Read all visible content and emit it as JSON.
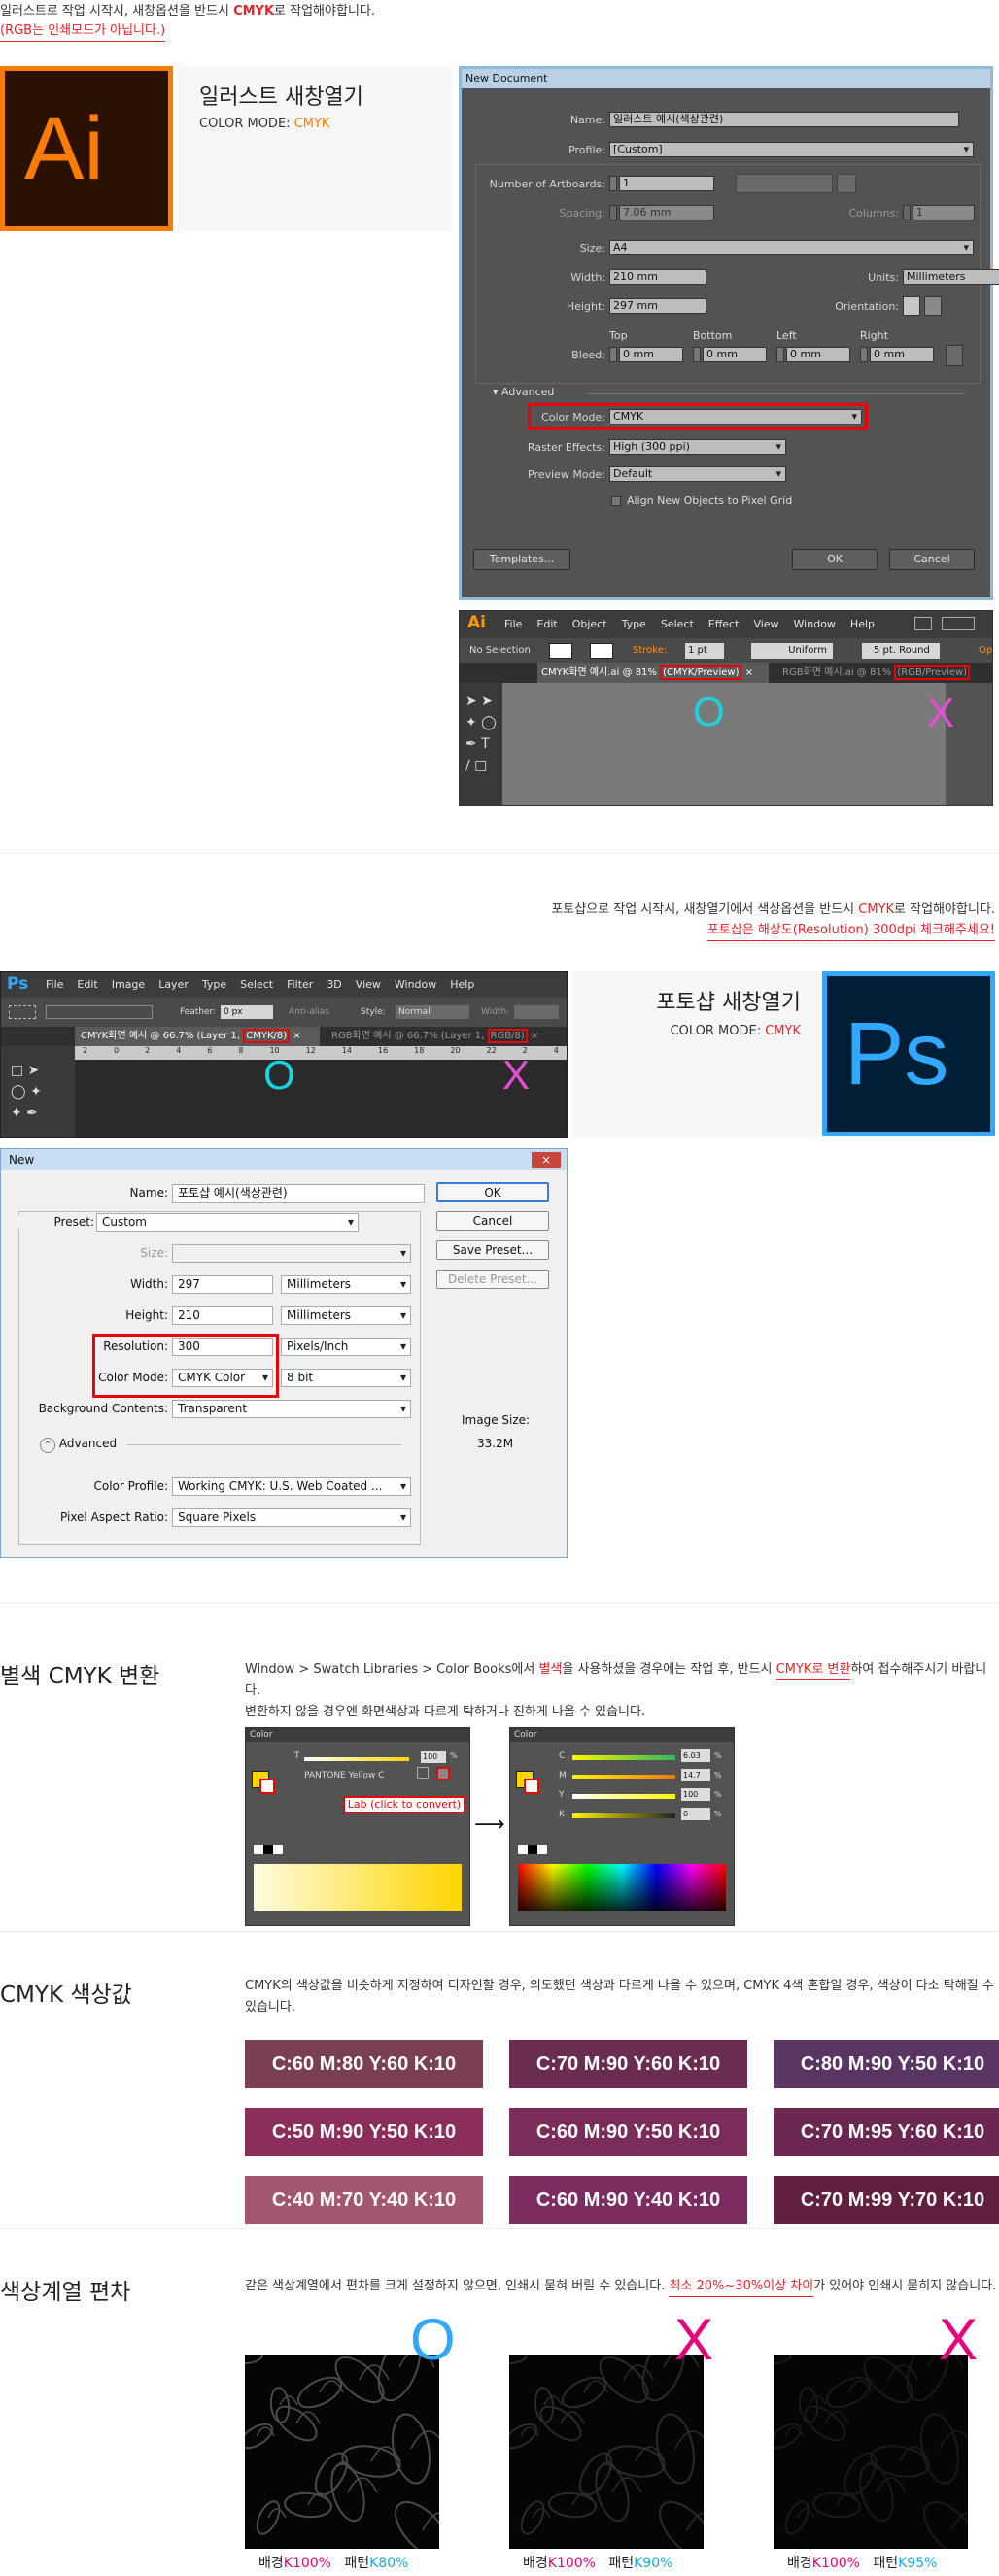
{
  "illustrator": {
    "notice": "일러스트로 작업 시작시, 새창옵션을 반드시 ",
    "notice_cmyk": "CMYK",
    "notice_end": "로 작업해야합니다.",
    "notice2": "(RGB는 인쇄모드가 아닙니다.)",
    "logo_text": "Ai",
    "card_title": "일러스트 새창열기",
    "card_mode_label": "COLOR MODE: ",
    "card_mode_value": "CMYK"
  },
  "ai_dialog": {
    "title": "New Document",
    "name_label": "Name:",
    "name_value": "일러스트 예시(색상관련)",
    "profile_label": "Profile:",
    "profile_value": "[Custom]",
    "artboards_label": "Number of Artboards:",
    "artboards_value": "1",
    "spacing_label": "Spacing:",
    "spacing_value": "7.06 mm",
    "columns_label": "Columns:",
    "columns_value": "1",
    "size_label": "Size:",
    "size_value": "A4",
    "width_label": "Width:",
    "width_value": "210 mm",
    "units_label": "Units:",
    "units_value": "Millimeters",
    "height_label": "Height:",
    "height_value": "297 mm",
    "orientation_label": "Orientation:",
    "bleed_label": "Bleed:",
    "bleed_top": "Top",
    "bleed_bottom": "Bottom",
    "bleed_left": "Left",
    "bleed_right": "Right",
    "bleed_value": "0 mm",
    "advanced_label": "Advanced",
    "colormode_label": "Color Mode:",
    "colormode_value": "CMYK",
    "raster_label": "Raster Effects:",
    "raster_value": "High (300 ppi)",
    "preview_label": "Preview Mode:",
    "preview_value": "Default",
    "align_label": "Align New Objects to Pixel Grid",
    "templates_btn": "Templates...",
    "ok_btn": "OK",
    "cancel_btn": "Cancel"
  },
  "ai_app": {
    "logo": "Ai",
    "menu": [
      "File",
      "Edit",
      "Object",
      "Type",
      "Select",
      "Effect",
      "View",
      "Window",
      "Help"
    ],
    "no_selection": "No Selection",
    "stroke": "Stroke:",
    "stroke_value": "1 pt",
    "uniform": "Uniform",
    "round": "5 pt. Round",
    "opacity": "Op",
    "tab1_prefix": "CMYK화면 예시.ai @ 81% ",
    "tab1_mode": "(CMYK/Preview)",
    "tab2_prefix": "RGB화면 예시.ai @ 81% ",
    "tab2_mode": "(RGB/Preview)",
    "mark_o": "O",
    "mark_x": "X"
  },
  "photoshop": {
    "notice": "포토샵으로 작업 시작시, 새창열기에서 색상옵션을 반드시 ",
    "notice_cmyk": "CMYK",
    "notice_end": "로 작업해야합니다.",
    "notice2": "포토샵은 해상도(Resolution) 300dpi 체크해주세요!",
    "card_title": "포토샵 새창열기",
    "card_mode_label": "COLOR MODE: ",
    "card_mode_value": "CMYK",
    "logo_text": "Ps"
  },
  "ps_app": {
    "logo": "Ps",
    "menu": [
      "File",
      "Edit",
      "Image",
      "Layer",
      "Type",
      "Select",
      "Filter",
      "3D",
      "View",
      "Window",
      "Help"
    ],
    "feather": "Feather:",
    "feather_value": "0 px",
    "antialias": "Anti-alias",
    "style": "Style:",
    "style_value": "Normal",
    "width_label": "Width:",
    "tab1_prefix": "CMYK화면 예시 @ 66.7% (Layer 1, ",
    "tab1_mode": "CMYK/8)",
    "tab2_prefix": "RGB화면 예시 @ 66.7% (Layer 1, ",
    "tab2_mode": "RGB/8)",
    "ruler": [
      "2",
      "0",
      "2",
      "4",
      "6",
      "8",
      "10",
      "12",
      "14",
      "16",
      "18",
      "20",
      "22",
      "2",
      "4"
    ],
    "mark_o": "O",
    "mark_x": "X"
  },
  "ps_dialog": {
    "title": "New",
    "name_label": "Name:",
    "name_value": "포토샵 예시(색상관련)",
    "preset_label": "Preset:",
    "preset_value": "Custom",
    "size_label": "Size:",
    "width_label": "Width:",
    "width_value": "297",
    "width_unit": "Millimeters",
    "height_label": "Height:",
    "height_value": "210",
    "height_unit": "Millimeters",
    "res_label": "Resolution:",
    "res_value": "300",
    "res_unit": "Pixels/Inch",
    "mode_label": "Color Mode:",
    "mode_value": "CMYK Color",
    "mode_bits": "8 bit",
    "bg_label": "Background Contents:",
    "bg_value": "Transparent",
    "advanced_label": "Advanced",
    "profile_label": "Color Profile:",
    "profile_value": "Working CMYK:  U.S. Web Coated ...",
    "aspect_label": "Pixel Aspect Ratio:",
    "aspect_value": "Square Pixels",
    "ok_btn": "OK",
    "cancel_btn": "Cancel",
    "save_btn": "Save Preset...",
    "delete_btn": "Delete Preset...",
    "image_size_label": "Image Size:",
    "image_size_value": "33.2M"
  },
  "spot": {
    "title": "별색 CMYK 변환",
    "desc1a": "Window > Swatch Libraries > Color Books에서 ",
    "desc1b": "별색",
    "desc1c": "을 사용하셨을 경우에는 작업 후, 반드시 ",
    "desc1d": "CMYK로 변환",
    "desc1e": "하여 접수해주시기 바랍니다.",
    "desc2": "변환하지 않을 경우엔 화면색상과 다르게 탁하거나 진하게 나올 수 있습니다.",
    "panel_title": "Color",
    "tint_label": "T",
    "tint_value": "100",
    "pct": "%",
    "pantone": "PANTONE Yellow C",
    "lab_callout": "Lab (click to convert)",
    "c_label": "C",
    "m_label": "M",
    "y_label": "Y",
    "k_label": "K",
    "c_value": "6.03",
    "m_value": "14.7",
    "y_value": "100",
    "k_value": "0"
  },
  "cmyk_values": {
    "title": "CMYK 색상값",
    "desc": "CMYK의 색상값을 비슷하게 지정하여 디자인할 경우, 의도했던 색상과 다르게 나올 수 있으며, CMYK 4색 혼합일 경우, 색상이 다소 탁해질 수 있습니다.",
    "swatches": [
      {
        "label": "C:60 M:80 Y:60 K:10",
        "color": "#7b3f52"
      },
      {
        "label": "C:70 M:90 Y:60 K:10",
        "color": "#6b2c52"
      },
      {
        "label": "C:80 M:90 Y:50 K:10",
        "color": "#5a3462"
      },
      {
        "label": "C:50 M:90 Y:50 K:10",
        "color": "#8c2e5a"
      },
      {
        "label": "C:60 M:90 Y:50 K:10",
        "color": "#7a2d5a"
      },
      {
        "label": "C:70 M:95 Y:60 K:10",
        "color": "#6b2651"
      },
      {
        "label": "C:40 M:70 Y:40 K:10",
        "color": "#a3576e"
      },
      {
        "label": "C:60 M:90 Y:40 K:10",
        "color": "#7b2d62"
      },
      {
        "label": "C:70 M:99 Y:70 K:10",
        "color": "#622040"
      }
    ]
  },
  "deviation": {
    "title": "색상계열 편차",
    "desc_a": "같은 색상계열에서 편차를 크게 설정하지 않으면, 인쇄시 묻혀 버릴 수 있습니다. ",
    "desc_b": "최소 20%~30%이상 차이",
    "desc_c": "가 있어야 인쇄시 묻히지 않습니다.",
    "samples": [
      {
        "mark": "O",
        "bg_label": "배경",
        "bg_value": "K100%",
        "pat_label": "패턴",
        "pat_value": "K80%"
      },
      {
        "mark": "X",
        "bg_label": "배경",
        "bg_value": "K100%",
        "pat_label": "패턴",
        "pat_value": "K90%"
      },
      {
        "mark": "X",
        "bg_label": "배경",
        "bg_value": "K100%",
        "pat_label": "패턴",
        "pat_value": "K95%"
      }
    ]
  },
  "colors": {
    "accent_red": "#e8232a",
    "ai_orange": "#ff7c00",
    "ps_blue": "#31a8ff",
    "cyan_mark": "#19d3e0",
    "magenta_mark": "#e64fd4",
    "pink_mark": "#e6007e"
  }
}
